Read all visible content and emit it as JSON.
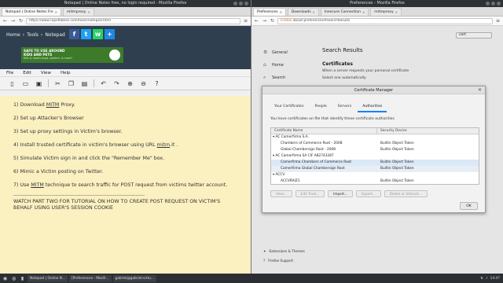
{
  "left_window": {
    "title": "Notepad | Online Notes free, no login required - Mozilla Firefox",
    "tabs": [
      {
        "label": "Notepad | Online Notes Fre",
        "active": true
      },
      {
        "label": "mitmproxy",
        "active": false
      }
    ],
    "url": "https://www.rapidtables.com/tools/notepad.html",
    "breadcrumb": [
      "Home",
      "›",
      "Tools",
      "›",
      "Notepad"
    ],
    "ad": {
      "line1": "SAFE TO USE AROUND",
      "line2": "KIDS AND PETS",
      "sub": "Kills & repels bugs, spiders, & more*"
    },
    "menu": [
      "File",
      "Edit",
      "View",
      "Help"
    ],
    "editor_lines": [
      {
        "before": "1) Download ",
        "link": "MITM",
        "after": " Proxy."
      },
      {
        "before": "2) Set up Attacker's Browser",
        "link": "",
        "after": ""
      },
      {
        "before": "3) Set up proxy settings in Victim's browser.",
        "link": "",
        "after": ""
      },
      {
        "before": "4) Install trusted certificate in victim's browser using URL ",
        "link": "mitm",
        "after": ".it ."
      },
      {
        "before": "5) Simulate Victim sign in and click the \"Remember Me\" box.",
        "link": "",
        "after": ""
      },
      {
        "before": "6) Mimic a Victim posting on Twitter.",
        "link": "",
        "after": ""
      },
      {
        "before": "7) Use ",
        "link": "MITM",
        "after": " technique to search traffic for POST request from victims twitter account."
      }
    ],
    "divider": "--------------------------------------------------------------------------------------------------------",
    "footer_text": "WATCH PART TWO FOR TUTORIAL ON HOW TO CREATE POST REQUEST ON VICTIM'S BEHALF USING USER'S SESSION COOKIE"
  },
  "right_window": {
    "title": "Preferences - Mozilla Firefox",
    "tabs": [
      {
        "label": "Preferences",
        "active": true
      },
      {
        "label": "Downloads",
        "active": false
      },
      {
        "label": "Insecure Connection",
        "active": false
      },
      {
        "label": "mitmproxy",
        "active": false
      }
    ],
    "url_prefix": "Firefox",
    "url": "about:preferences#searchResults",
    "sidebar": [
      {
        "label": "General",
        "icon": "gear-icon"
      },
      {
        "label": "Home",
        "icon": "home-icon"
      },
      {
        "label": "Search",
        "icon": "search-icon"
      }
    ],
    "search_value": "cert",
    "results_title": "Search Results",
    "section_title": "Certificates",
    "section_text": "When a server requests your personal certificate",
    "option": "Select one automatically",
    "footer_links": [
      "Extensions & Themes",
      "Firefox Support"
    ]
  },
  "dialog": {
    "title": "Certificate Manager",
    "tabs": [
      "Your Certificates",
      "People",
      "Servers",
      "Authorities"
    ],
    "active_tab": "Authorities",
    "info": "You have certificates on file that identify these certificate authorities",
    "columns": [
      "Certificate Name",
      "Security Device"
    ],
    "rows": [
      {
        "type": "group",
        "name": "AC Camerfirma S.A.",
        "device": ""
      },
      {
        "type": "child",
        "name": "Chambers of Commerce Root - 2008",
        "device": "Builtin Object Token"
      },
      {
        "type": "child",
        "name": "Global Chambersign Root - 2008",
        "device": "Builtin Object Token"
      },
      {
        "type": "group",
        "name": "AC Camerfirma SA CIF A82743287",
        "device": ""
      },
      {
        "type": "child",
        "name": "Camerfirma Chambers of Commerce Root",
        "device": "Builtin Object Token",
        "state": "sel"
      },
      {
        "type": "child",
        "name": "Camerfirma Global Chambersign Root",
        "device": "Builtin Object Token",
        "state": "hover"
      },
      {
        "type": "group",
        "name": "ACCV",
        "device": ""
      },
      {
        "type": "child",
        "name": "ACCVRAIZ1",
        "device": "Builtin Object Token"
      }
    ],
    "buttons": [
      {
        "label": "View...",
        "enabled": false
      },
      {
        "label": "Edit Trust...",
        "enabled": false
      },
      {
        "label": "Import...",
        "enabled": true
      },
      {
        "label": "Export...",
        "enabled": false
      },
      {
        "label": "Delete or Distrust...",
        "enabled": false
      }
    ],
    "ok_label": "OK"
  },
  "taskbar": {
    "items": [
      "Notepad | Online N...",
      "[Preferences - Mozill...",
      "gabriel@gabriel-virtu..."
    ],
    "time": "14:47"
  }
}
